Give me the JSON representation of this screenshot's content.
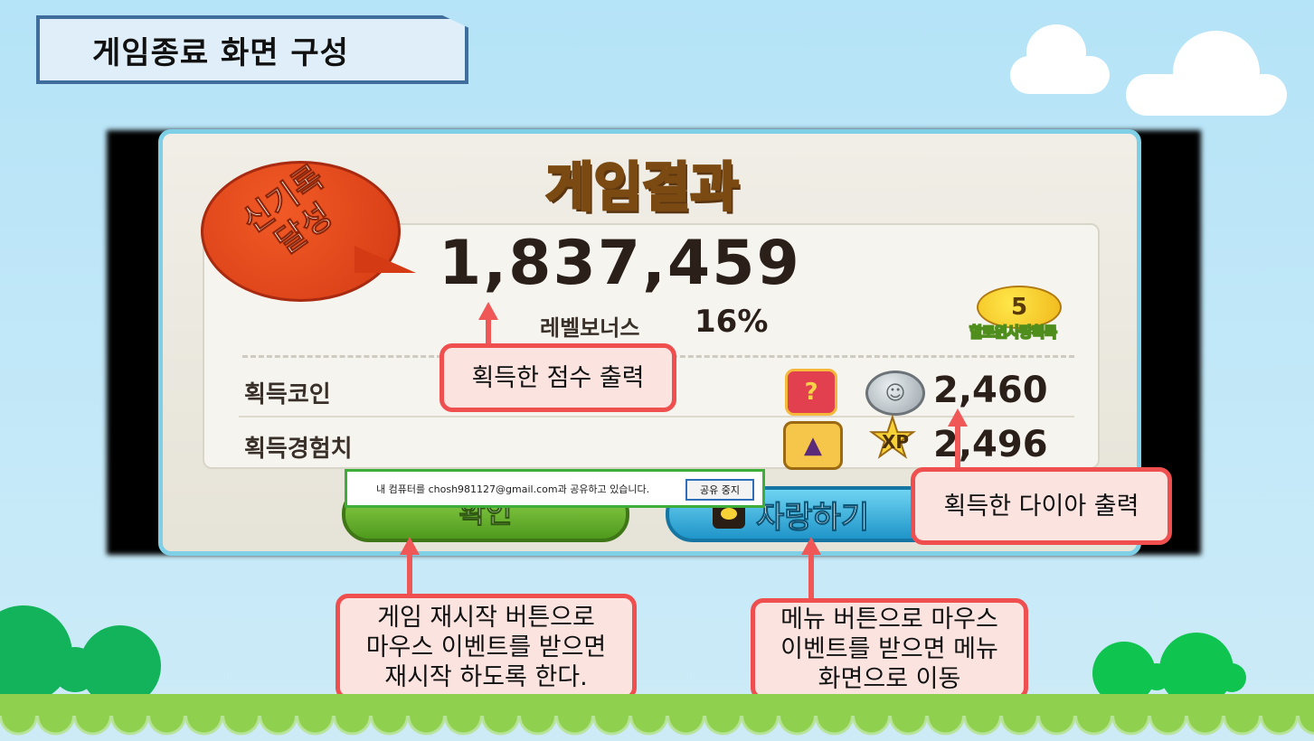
{
  "slide": {
    "title": "게임종료 화면 구성"
  },
  "game": {
    "result_title": "게임결과",
    "record_badge": "신기록\n달성",
    "score": "1,837,459",
    "level_bonus_label": "레벨보너스",
    "level_bonus_value": "16%",
    "candy_number": "5",
    "candy_caption": "할로윈사탕획득",
    "rows": [
      {
        "label": "획득코인",
        "value": "2,460"
      },
      {
        "label": "획득경험치",
        "value": "2,496"
      }
    ],
    "confirm_button": "확인",
    "brag_button": "자랑하기",
    "xp_badge": "XP",
    "chest_symbol": "?"
  },
  "share_bar": {
    "message": "내 컴퓨터를 chosh981127@gmail.com과 공유하고 있습니다.",
    "stop_button": "공유 중지"
  },
  "callouts": {
    "score": "획득한 점수 출력",
    "diamond": "획득한 다이아 출력",
    "restart": "게임 재시작 버튼으로\n마우스 이벤트를 받으면\n재시작 하도록 한다.",
    "menu": "메뉴 버튼으로 마우스\n이벤트를 받으면 메뉴\n화면으로 이동"
  },
  "colors": {
    "callout_border": "#ef4f4f",
    "callout_fill": "#fbe3e0",
    "title_border": "#3f6e9c",
    "sky": "#b5e3f7",
    "grass": "#8fd14f"
  },
  "icons": [
    "chest-icon",
    "coin-icon",
    "witch-hat-icon",
    "xp-star-icon",
    "talk-bubble-icon",
    "candy-icon",
    "cloud-icon",
    "bush-icon"
  ]
}
